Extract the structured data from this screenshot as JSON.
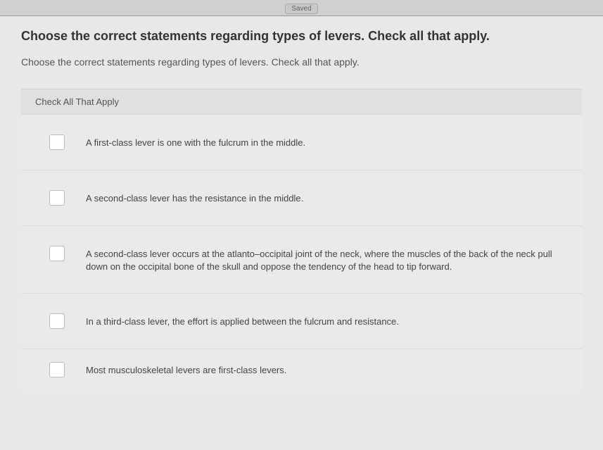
{
  "topbar": {
    "saved_label": "Saved"
  },
  "question": {
    "heading": "Choose the correct statements regarding types of levers. Check all that apply.",
    "subheading": "Choose the correct statements regarding types of levers. Check all that apply.",
    "check_all_label": "Check All That Apply"
  },
  "options": [
    {
      "text": "A first-class lever is one with the fulcrum in the middle."
    },
    {
      "text": "A second-class lever has the resistance in the middle."
    },
    {
      "text": "A second-class lever occurs at the atlanto–occipital joint of the neck, where the muscles of the back of the neck pull down on the occipital bone of the skull and oppose the tendency of the head to tip forward."
    },
    {
      "text": "In a third-class lever, the effort is applied between the fulcrum and resistance."
    },
    {
      "text": "Most musculoskeletal levers are first-class levers."
    }
  ]
}
